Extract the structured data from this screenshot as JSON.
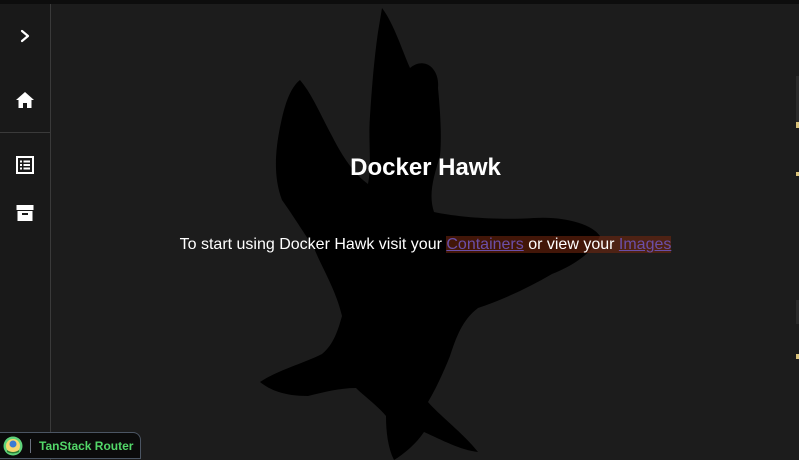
{
  "app": {
    "title": "Docker Hawk"
  },
  "sidebar": {
    "items": [
      {
        "name": "expand",
        "icon": "chevron-right-icon"
      },
      {
        "name": "home",
        "icon": "home-icon"
      },
      {
        "name": "containers",
        "icon": "list-icon"
      },
      {
        "name": "images",
        "icon": "archive-icon"
      }
    ]
  },
  "main": {
    "title": "Docker Hawk",
    "intro_prefix": "To start using Docker Hawk visit your ",
    "containers_link": "Containers",
    "intro_middle": " or view your ",
    "images_link": "Images"
  },
  "devtools": {
    "label": "TanStack Router"
  },
  "colors": {
    "background": "#1c1c1c",
    "sidebar": "#191919",
    "link": "#6b4fa8",
    "devtools_label": "#53d769"
  }
}
